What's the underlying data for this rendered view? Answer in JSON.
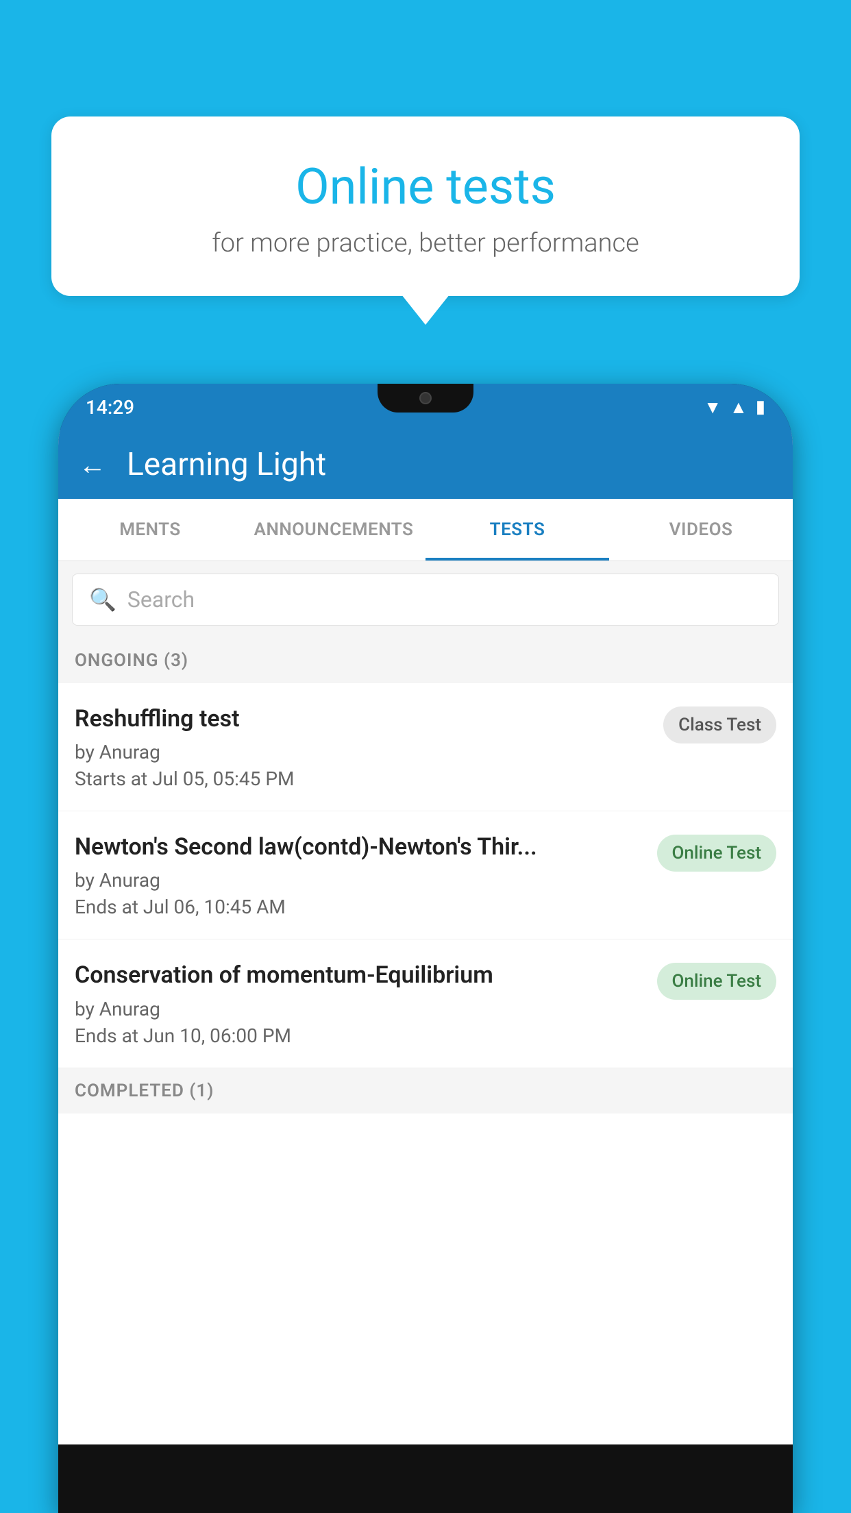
{
  "background_color": "#1ab5e8",
  "speech_bubble": {
    "title": "Online tests",
    "subtitle": "for more practice, better performance"
  },
  "status_bar": {
    "time": "14:29",
    "icons": [
      "wifi",
      "signal",
      "battery"
    ]
  },
  "app_bar": {
    "title": "Learning Light",
    "back_label": "←"
  },
  "tabs": [
    {
      "label": "MENTS",
      "active": false
    },
    {
      "label": "ANNOUNCEMENTS",
      "active": false
    },
    {
      "label": "TESTS",
      "active": true
    },
    {
      "label": "VIDEOS",
      "active": false
    }
  ],
  "search": {
    "placeholder": "Search"
  },
  "sections": [
    {
      "header": "ONGOING (3)",
      "items": [
        {
          "title": "Reshuffling test",
          "author": "by Anurag",
          "time_label": "Starts at",
          "time": "Jul 05, 05:45 PM",
          "badge": "Class Test",
          "badge_type": "class"
        },
        {
          "title": "Newton's Second law(contd)-Newton's Thir...",
          "author": "by Anurag",
          "time_label": "Ends at",
          "time": "Jul 06, 10:45 AM",
          "badge": "Online Test",
          "badge_type": "online"
        },
        {
          "title": "Conservation of momentum-Equilibrium",
          "author": "by Anurag",
          "time_label": "Ends at",
          "time": "Jun 10, 06:00 PM",
          "badge": "Online Test",
          "badge_type": "online"
        }
      ]
    }
  ],
  "completed_section": {
    "header": "COMPLETED (1)"
  }
}
